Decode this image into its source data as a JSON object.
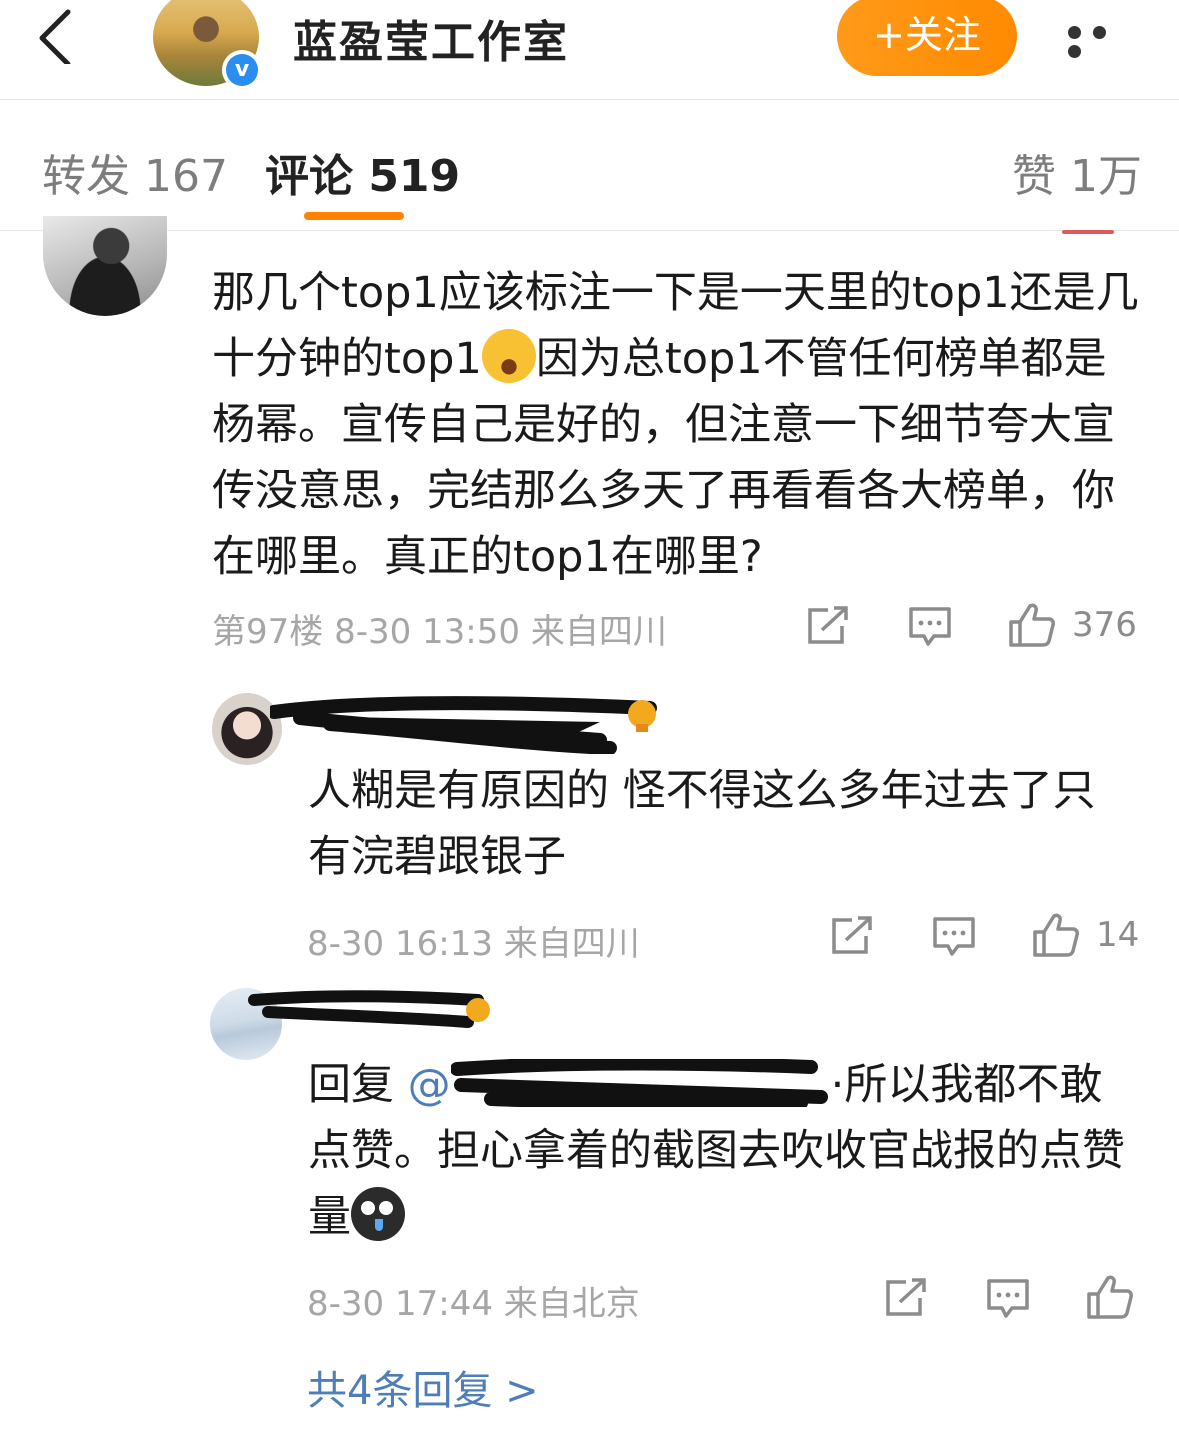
{
  "header": {
    "account_name": "蓝盈莹工作室",
    "follow_label": "+关注",
    "verified": true,
    "accent_color": "#ff8200"
  },
  "tabs": [
    {
      "label": "转发 167",
      "active": false
    },
    {
      "label": "评论 519",
      "active": true
    },
    {
      "label": "赞 1万",
      "active": false
    }
  ],
  "main_comment": {
    "text_parts": [
      "那几个top1应该标注一下是一天里的top1还是几十分钟的top1",
      "因为总top1不管任何榜单都是杨幂。宣传自己是好的，但注意一下细节夸大宣传没意思，完结那么多天了再看看各大榜单，你在哪里。真正的top1在哪里?"
    ],
    "meta": "第97楼 8-30 13:50  来自四川",
    "like_count": "376"
  },
  "replies": [
    {
      "text": "人糊是有原因的 怪不得这么多年过去了只有浣碧跟银子",
      "meta": "8-30 16:13  来自四川",
      "like_count": "14"
    },
    {
      "prefix": "回复 ",
      "mention": "@",
      "text": "·所以我都不敢点赞。担心拿着的截图去吹收官战报的点赞量",
      "meta": "8-30 17:44  来自北京",
      "like_count": ""
    }
  ],
  "more_replies_label": "共4条回复 >"
}
